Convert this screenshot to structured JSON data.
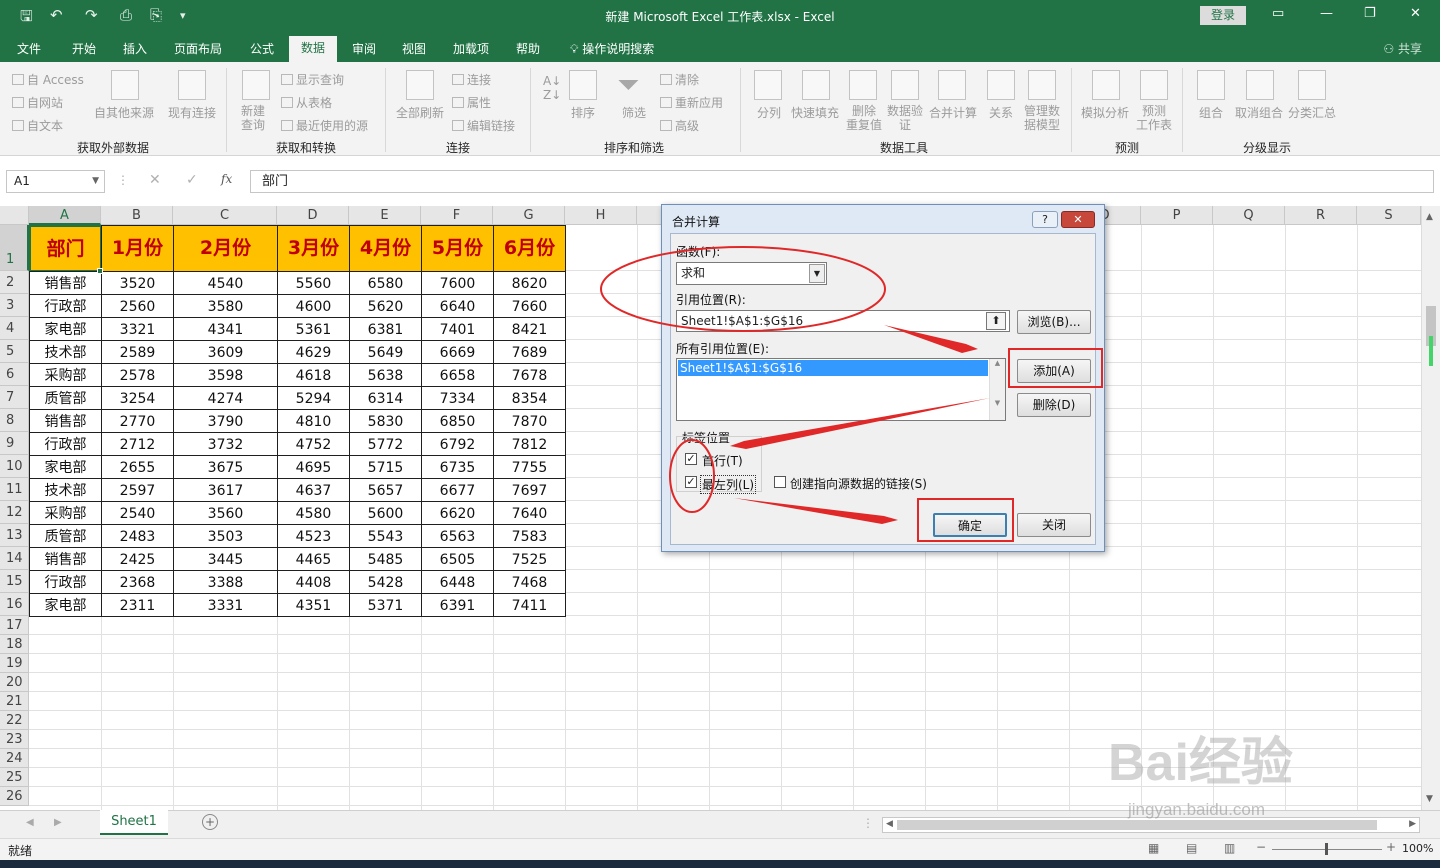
{
  "window": {
    "title": "新建 Microsoft Excel 工作表.xlsx  -  Excel",
    "login": "登录",
    "share": "共享"
  },
  "menu": [
    "文件",
    "开始",
    "插入",
    "页面布局",
    "公式",
    "数据",
    "审阅",
    "视图",
    "加载项",
    "帮助"
  ],
  "tellme": "操作说明搜索",
  "ribbon": {
    "get_external": {
      "items": [
        "自 Access",
        "自网站",
        "自文本"
      ],
      "other": "自其他来源",
      "existing": "现有连接",
      "label": "获取外部数据"
    },
    "get_transform": {
      "new_query": "新建\n查询",
      "items": [
        "显示查询",
        "从表格",
        "最近使用的源"
      ],
      "label": "获取和转换"
    },
    "connections": {
      "refresh": "全部刷新",
      "items": [
        "连接",
        "属性",
        "编辑链接"
      ],
      "label": "连接"
    },
    "sort_filter": {
      "sort": "排序",
      "filter": "筛选",
      "items": [
        "清除",
        "重新应用",
        "高级"
      ],
      "label": "排序和筛选"
    },
    "data_tools": {
      "items": [
        "分列",
        "快速填充",
        "删除\n重复值",
        "数据验\n证",
        "合并计算",
        "关系",
        "管理数\n据模型"
      ],
      "label": "数据工具"
    },
    "forecast": {
      "items": [
        "模拟分析",
        "预测\n工作表"
      ],
      "label": "预测"
    },
    "outline": {
      "items": [
        "组合",
        "取消组合",
        "分类汇总"
      ],
      "label": "分级显示"
    }
  },
  "namebox": "A1",
  "formula": "部门",
  "columns": [
    "A",
    "B",
    "C",
    "D",
    "E",
    "F",
    "G",
    "H",
    "I",
    "J",
    "K",
    "L",
    "M",
    "N",
    "O",
    "P",
    "Q",
    "R",
    "S"
  ],
  "rows": [
    "1",
    "2",
    "3",
    "4",
    "5",
    "6",
    "7",
    "8",
    "9",
    "10",
    "11",
    "12",
    "13",
    "14",
    "15",
    "16",
    "17",
    "18",
    "19",
    "20",
    "21",
    "22",
    "23",
    "24",
    "25",
    "26"
  ],
  "table": {
    "headers": [
      "部门",
      "1月份",
      "2月份",
      "3月份",
      "4月份",
      "5月份",
      "6月份"
    ],
    "rows": [
      [
        "销售部",
        "3520",
        "4540",
        "5560",
        "6580",
        "7600",
        "8620"
      ],
      [
        "行政部",
        "2560",
        "3580",
        "4600",
        "5620",
        "6640",
        "7660"
      ],
      [
        "家电部",
        "3321",
        "4341",
        "5361",
        "6381",
        "7401",
        "8421"
      ],
      [
        "技术部",
        "2589",
        "3609",
        "4629",
        "5649",
        "6669",
        "7689"
      ],
      [
        "采购部",
        "2578",
        "3598",
        "4618",
        "5638",
        "6658",
        "7678"
      ],
      [
        "质管部",
        "3254",
        "4274",
        "5294",
        "6314",
        "7334",
        "8354"
      ],
      [
        "销售部",
        "2770",
        "3790",
        "4810",
        "5830",
        "6850",
        "7870"
      ],
      [
        "行政部",
        "2712",
        "3732",
        "4752",
        "5772",
        "6792",
        "7812"
      ],
      [
        "家电部",
        "2655",
        "3675",
        "4695",
        "5715",
        "6735",
        "7755"
      ],
      [
        "技术部",
        "2597",
        "3617",
        "4637",
        "5657",
        "6677",
        "7697"
      ],
      [
        "采购部",
        "2540",
        "3560",
        "4580",
        "5600",
        "6620",
        "7640"
      ],
      [
        "质管部",
        "2483",
        "3503",
        "4523",
        "5543",
        "6563",
        "7583"
      ],
      [
        "销售部",
        "2425",
        "3445",
        "4465",
        "5485",
        "6505",
        "7525"
      ],
      [
        "行政部",
        "2368",
        "3388",
        "4408",
        "5428",
        "6448",
        "7468"
      ],
      [
        "家电部",
        "2311",
        "3331",
        "4351",
        "5371",
        "6391",
        "7411"
      ]
    ]
  },
  "dialog": {
    "title": "合并计算",
    "function_label": "函数(F):",
    "function_value": "求和",
    "ref_label": "引用位置(R):",
    "ref_value": "Sheet1!$A$1:$G$16",
    "browse": "浏览(B)...",
    "all_refs_label": "所有引用位置(E):",
    "all_refs": [
      "Sheet1!$A$1:$G$16"
    ],
    "add": "添加(A)",
    "delete": "删除(D)",
    "label_pos": "标签位置",
    "top_row": "首行(T)",
    "left_col": "最左列(L)",
    "link_source": "创建指向源数据的链接(S)",
    "ok": "确定",
    "close": "关闭"
  },
  "sheet_tab": "Sheet1",
  "status": {
    "ready": "就绪",
    "zoom": "100%"
  },
  "watermark": {
    "brand": "Bai经验",
    "url": "jingyan.baidu.com"
  }
}
